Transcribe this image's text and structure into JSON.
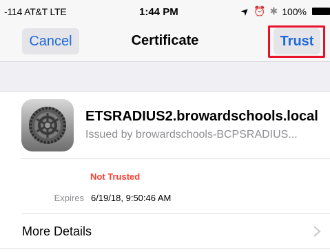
{
  "status_bar": {
    "carrier": "-114 AT&T  LTE",
    "time": "1:44 PM",
    "location_glyph": "➤",
    "alarm_glyph": "⏰",
    "bluetooth_glyph": "✱",
    "battery": "100%"
  },
  "nav": {
    "cancel_label": "Cancel",
    "title": "Certificate",
    "trust_label": "Trust",
    "highlight_color": "#e8102a"
  },
  "certificate": {
    "name": "ETSRADIUS2.browardschools.local",
    "issuer": "Issued by browardschools-BCPSRADIUS...",
    "icon": "gear-icon"
  },
  "details": {
    "trust_status": "Not Trusted",
    "expires_label": "Expires",
    "expires_value": "6/19/18, 9:50:46 AM"
  },
  "more": {
    "label": "More Details"
  },
  "colors": {
    "accent": "#1e6ad6",
    "danger": "#ff3b30",
    "secondary_text": "#8e8e93"
  }
}
